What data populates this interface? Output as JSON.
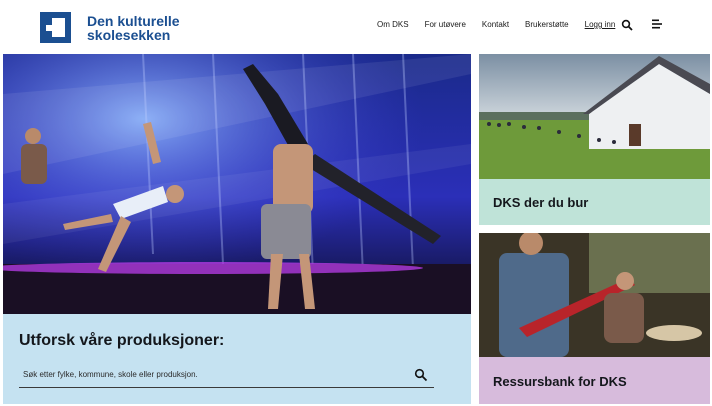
{
  "brand": {
    "line1": "Den kulturelle",
    "line2": "skolesekken",
    "color": "#1b4f91"
  },
  "nav": {
    "items": [
      "Om DKS",
      "For utøvere",
      "Kontakt",
      "Brukerstøtte"
    ],
    "login": "Logg inn",
    "search_icon": "search-icon",
    "menu_icon": "hamburger-menu-icon"
  },
  "hero": {
    "title": "Utforsk våre produksjoner:",
    "search_placeholder": "Søk etter fylke, kommune, skole eller produksjon.",
    "panel_color": "#c5e2f1"
  },
  "cards": [
    {
      "label": "DKS der du bur",
      "color": "#bfe3d8"
    },
    {
      "label": "Ressursbank for DKS",
      "color": "#d7bbdc"
    }
  ]
}
